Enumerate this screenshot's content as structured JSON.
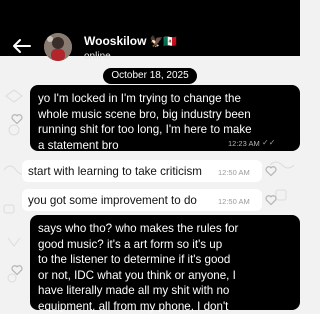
{
  "header": {
    "contact_name": "Wooskilow",
    "name_badges": "🦅🇲🇽",
    "status": "online"
  },
  "date_chip": "October 18, 2025",
  "messages": [
    {
      "direction": "outgoing",
      "lines": [
        "yo I'm locked in I'm trying to change the",
        "whole music scene bro, big industry been",
        "running shit for too long, I'm here to make",
        "a statement bro"
      ],
      "time": "12:23 AM",
      "ticks": "✓✓"
    },
    {
      "direction": "incoming",
      "lines": [
        "start with learning to take criticism"
      ],
      "time": "12:50 AM"
    },
    {
      "direction": "incoming",
      "lines": [
        "you got some improvement to do"
      ],
      "time": "12:50 AM"
    },
    {
      "direction": "outgoing",
      "lines": [
        "says who tho? who makes the rules for",
        "good music? it's a art form so it's up",
        "to the listener to determine if it's good",
        "or not, IDC what you think or anyone, I",
        "have literally made all my shit with no",
        "equipment, all from my phone, I don't"
      ]
    }
  ],
  "colors": {
    "header_bg": "#000000",
    "outgoing_bubble": "#000000",
    "incoming_bubble": "#ffffff",
    "chat_bg": "#f2f2f2"
  },
  "icons": [
    "back-arrow-icon",
    "heart-icon",
    "double-check-icon"
  ]
}
